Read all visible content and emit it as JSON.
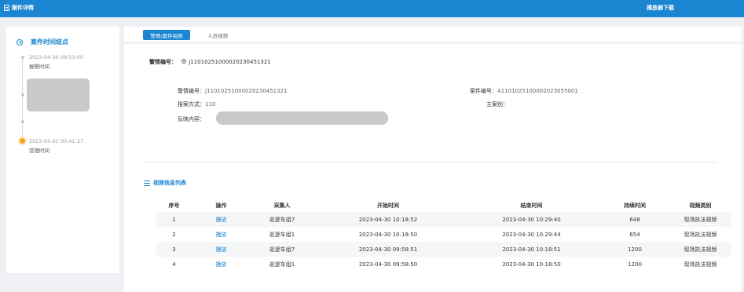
{
  "header": {
    "title": "案件详情",
    "download": "播放器下载"
  },
  "sidebar": {
    "title": "案件时间结点",
    "events": [
      {
        "date": "2023-04-30 09:53:00",
        "label": "报警时间"
      },
      {
        "date": "2023-05-01 00:41:37",
        "label": "受理时间"
      }
    ]
  },
  "tabs": [
    {
      "label": "警情/案件视频"
    },
    {
      "label": "人员视频"
    }
  ],
  "alarm_select": {
    "label": "警情编号：",
    "value": "J11010251000020230451321"
  },
  "details": {
    "alarm_no": {
      "label": "警情编号：",
      "value": "J11010251000020230451321"
    },
    "report_method": {
      "label": "报案方式：",
      "value": "110"
    },
    "content": {
      "label": "反映内容："
    },
    "case_no": {
      "label": "案件编号：",
      "value": "A11010251000020230550​01"
    },
    "main_category": {
      "label": "主案别：",
      "value": ""
    }
  },
  "video_list": {
    "title": "视频信息列表",
    "columns": [
      "序号",
      "操作",
      "采集人",
      "开始时间",
      "结束时间",
      "持续时间",
      "视频类别"
    ],
    "rows": [
      [
        "1",
        "播放",
        "巡逻车组7",
        "2023-04-30 10:18:52",
        "2023-04-30 10:29:40",
        "648",
        "现场执法视频"
      ],
      [
        "2",
        "播放",
        "巡逻车组1",
        "2023-04-30 10:18:50",
        "2023-04-30 10:29:44",
        "654",
        "现场执法视频"
      ],
      [
        "3",
        "播放",
        "巡逻车组7",
        "2023-04-30 09:58:51",
        "2023-04-30 10:18:51",
        "1200",
        "现场执法视频"
      ],
      [
        "4",
        "播放",
        "巡逻车组1",
        "2023-04-30 09:58:50",
        "2023-04-30 10:18:50",
        "1200",
        "现场执法视频"
      ]
    ]
  },
  "colors": {
    "accent": "#1a85d0",
    "active_dot": "#f5a623"
  }
}
